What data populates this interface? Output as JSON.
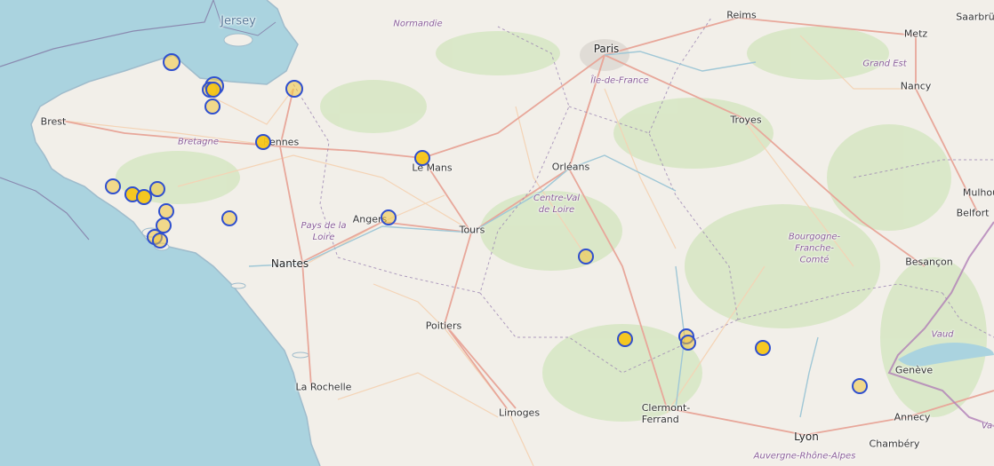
{
  "map": {
    "colors": {
      "sea": "#aad3df",
      "land": "#f2efe9",
      "forest": "#d6e6c3",
      "road_major": "#e8a79a",
      "road_minor": "#f4d3b5",
      "boundary": "#9c86b3",
      "marker_fill": "#f5c518",
      "marker_stroke": "#2f4fce"
    },
    "labels": {
      "jersey": "Jersey",
      "normandie": "Normandie",
      "paris": "Paris",
      "reims": "Reims",
      "saarbrucken": "Saarbrü",
      "metz": "Metz",
      "grand_est": "Grand Est",
      "ile_de_france": "Île-de-France",
      "nancy": "Nancy",
      "troyes": "Troyes",
      "brest": "Brest",
      "bretagne": "Bretagne",
      "rennes": "Rennes",
      "le_mans": "Le Mans",
      "orleans": "Orléans",
      "centre_val_de_loire_1": "Centre-Val",
      "centre_val_de_loire_2": "de Loire",
      "mulhouse": "Mulhou",
      "belfort": "Belfort",
      "angers": "Angers",
      "tours": "Tours",
      "pays_de_la_loire_1": "Pays de la",
      "pays_de_la_loire_2": "Loire",
      "bourgogne_1": "Bourgogne-",
      "bourgogne_2": "Franche-",
      "bourgogne_3": "Comté",
      "nantes": "Nantes",
      "besancon": "Besançon",
      "poitiers": "Poitiers",
      "vaud": "Vaud",
      "geneve": "Genève",
      "la_rochelle": "La Rochelle",
      "limoges": "Limoges",
      "clermont_1": "Clermont-",
      "clermont_2": "Ferrand",
      "annecy": "Annecy",
      "lyon": "Lyon",
      "chambery": "Chambéry",
      "auvergne": "Auvergne-Rhône-Alpes",
      "va": "Va"
    },
    "markers": [
      {
        "style": "faint"
      },
      {
        "style": "faint"
      },
      {
        "style": "faint"
      },
      {
        "style": "solid"
      },
      {
        "style": "faint"
      },
      {
        "style": "faint"
      },
      {
        "style": "solid"
      },
      {
        "style": "solid"
      },
      {
        "style": "faint"
      },
      {
        "style": "solid"
      },
      {
        "style": "solid"
      },
      {
        "style": "faint"
      },
      {
        "style": "faint"
      },
      {
        "style": "faint"
      },
      {
        "style": "faint"
      },
      {
        "style": "faint"
      },
      {
        "style": "faint"
      },
      {
        "style": "faint"
      },
      {
        "style": "solid"
      },
      {
        "style": "faint"
      },
      {
        "style": "faint"
      },
      {
        "style": "solid"
      },
      {
        "style": "faint"
      }
    ]
  }
}
